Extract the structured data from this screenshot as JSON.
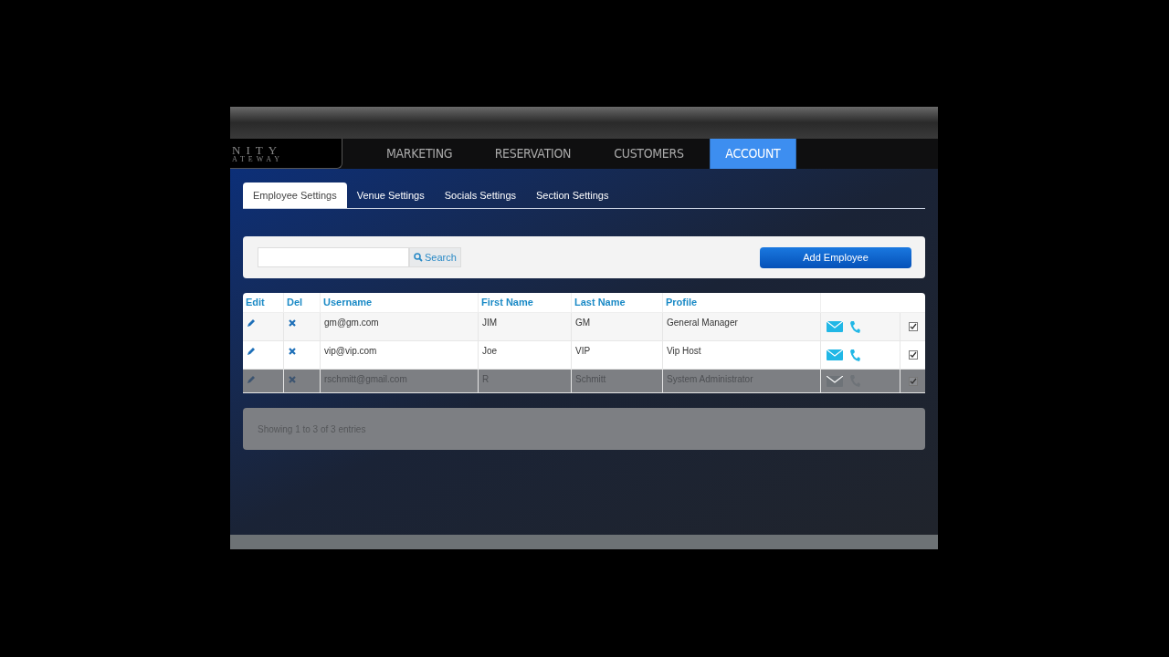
{
  "logo": {
    "line_1": "NITY",
    "line_2": "ATEWAY"
  },
  "nav": [
    {
      "label": "MARKETING",
      "selected": false
    },
    {
      "label": "RESERVATION",
      "selected": false
    },
    {
      "label": "CUSTOMERS",
      "selected": false
    },
    {
      "label": "ACCOUNT",
      "selected": true
    }
  ],
  "tabs": [
    {
      "label": "Employee Settings",
      "selected": true
    },
    {
      "label": "Venue Settings",
      "selected": false
    },
    {
      "label": "Socials Settings",
      "selected": false
    },
    {
      "label": "Section Settings",
      "selected": false
    }
  ],
  "search": {
    "button": "Search"
  },
  "add_button": "Add Employee",
  "table": {
    "columns": [
      "Edit",
      "Del",
      "Username",
      "First Name",
      "Last Name",
      "Profile"
    ],
    "rows": [
      {
        "username": "gm@gm.com",
        "first_name": "JIM",
        "last_name": "GM",
        "profile": "General Manager",
        "checked": true,
        "dimmed": false
      },
      {
        "username": "vip@vip.com",
        "first_name": "Joe",
        "last_name": "VIP",
        "profile": "Vip Host",
        "checked": true,
        "dimmed": false
      },
      {
        "username": "rschmitt@gmail.com",
        "first_name": "R",
        "last_name": "Schmitt",
        "profile": "System Administrator",
        "checked": true,
        "dimmed": true
      }
    ]
  },
  "footer": "Showing 1 to 3 of 3 entries"
}
